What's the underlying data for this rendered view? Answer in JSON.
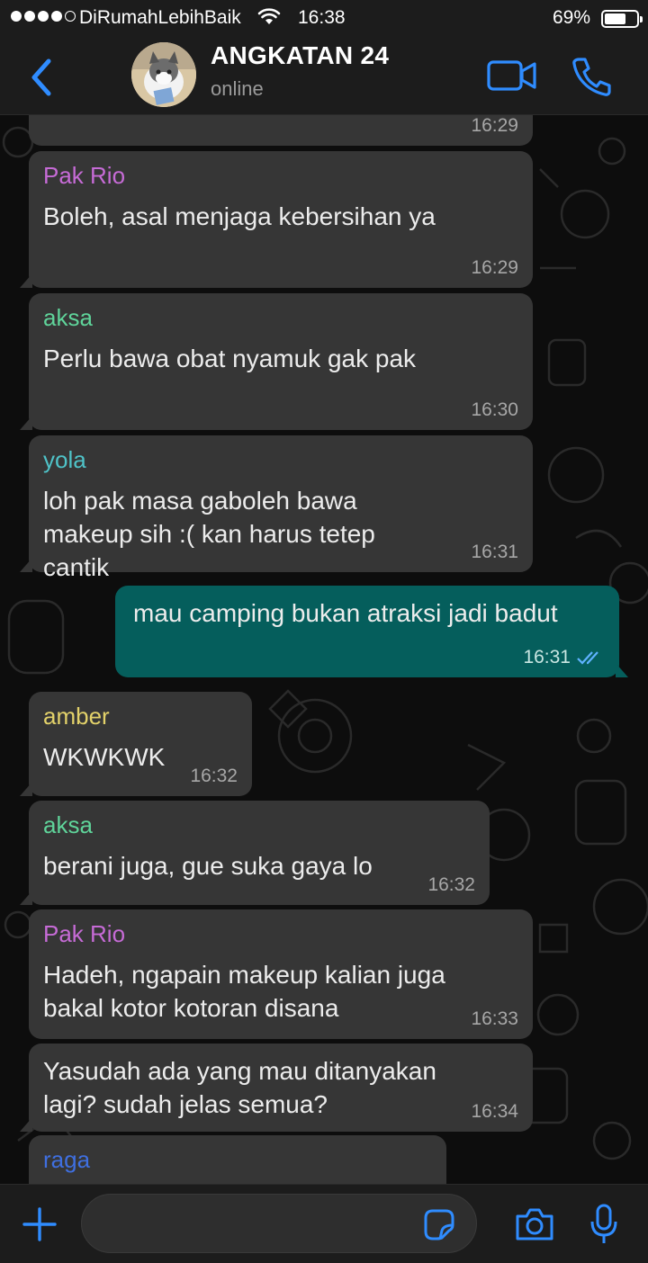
{
  "status_bar": {
    "carrier": "DiRumahLebihBaik",
    "time": "16:38",
    "battery_percent_label": "69%",
    "battery_level": 0.69
  },
  "header": {
    "title": "ANGKATAN 24",
    "subtitle": "online"
  },
  "messages": [
    {
      "time": "16:29"
    },
    {
      "sender": "Pak Rio",
      "text": "Boleh, asal menjaga kebersihan ya",
      "time": "16:29"
    },
    {
      "sender": "aksa",
      "text": "Perlu bawa obat nyamuk gak pak",
      "time": "16:30"
    },
    {
      "sender": "yola",
      "text": "loh pak masa gaboleh bawa makeup sih :( kan harus tetep cantik",
      "time": "16:31"
    },
    {
      "text": "mau camping bukan atraksi jadi badut",
      "time": "16:31"
    },
    {
      "sender": "amber",
      "text": "WKWKWK",
      "time": "16:32"
    },
    {
      "sender": "aksa",
      "text": "berani juga, gue suka gaya lo",
      "time": "16:32"
    },
    {
      "sender": "Pak Rio",
      "text": "Hadeh, ngapain makeup kalian juga bakal kotor kotoran disana",
      "time": "16:33"
    },
    {
      "text": "Yasudah ada yang mau ditanyakan lagi? sudah jelas semua?",
      "time": "16:34"
    },
    {
      "sender": "raga"
    }
  ],
  "colors": {
    "accent": "#2f8cff",
    "outgoing_bubble": "#055e5c",
    "incoming_bubble": "#363636",
    "sender_pak_rio": "#c66bd6",
    "sender_aksa": "#5fd49a",
    "sender_yola": "#4fc3c8",
    "sender_amber": "#e3d26a",
    "sender_raga": "#3f6fe0"
  },
  "icons": {
    "back": "chevron-left-icon",
    "video_call": "video-camera-icon",
    "voice_call": "phone-icon",
    "attach": "plus-icon",
    "sticker": "sticker-icon",
    "camera": "camera-icon",
    "mic": "microphone-icon",
    "read_receipt": "double-check-icon"
  }
}
